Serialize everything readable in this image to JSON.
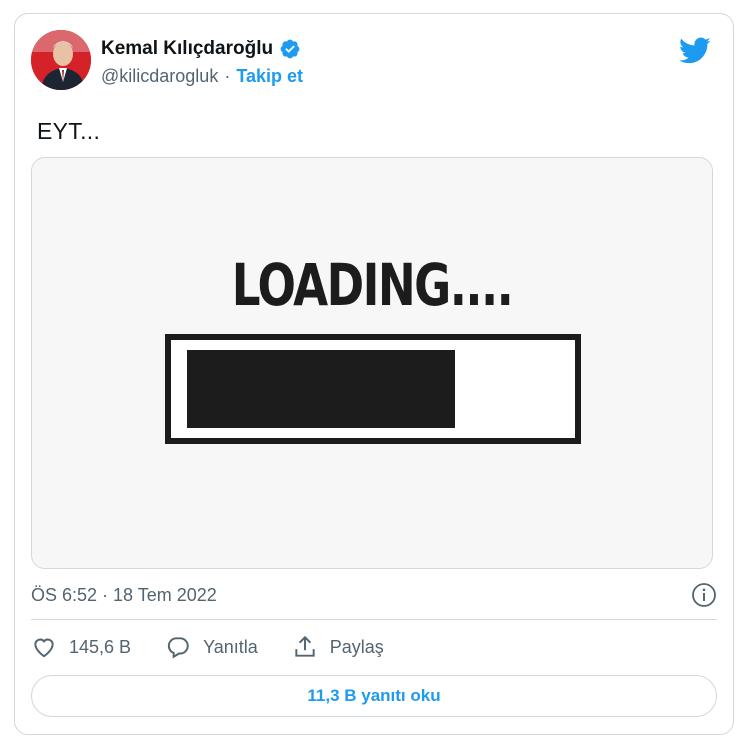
{
  "author": {
    "display_name": "Kemal Kılıçdaroğlu",
    "handle": "@kilicdarogluk",
    "separator": "·",
    "follow_label": "Takip et"
  },
  "tweet": {
    "text": "EYT..."
  },
  "media": {
    "loading_text": "LOADING....",
    "progress": 0.72
  },
  "meta": {
    "timestamp": "ÖS 6:52 · 18 Tem 2022"
  },
  "actions": {
    "likes": "145,6 B",
    "reply_label": "Yanıtla",
    "share_label": "Paylaş"
  },
  "replies_button": "11,3 B yanıtı oku",
  "colors": {
    "accent": "#1d9bf0",
    "text": "#0f1419",
    "muted": "#536471",
    "border": "#cfd9de"
  }
}
